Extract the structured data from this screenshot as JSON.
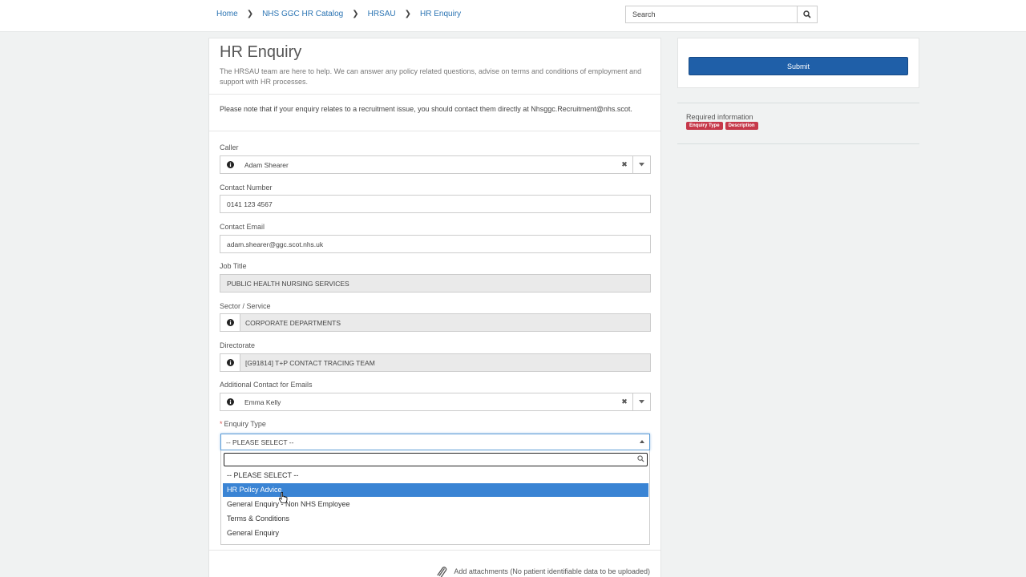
{
  "breadcrumb": [
    "Home",
    "NHS GGC HR Catalog",
    "HRSAU",
    "HR Enquiry"
  ],
  "search": {
    "placeholder": "Search"
  },
  "form": {
    "title": "HR Enquiry",
    "intro": "The HRSAU team are here to help. We can answer any policy related questions, advise on terms and conditions of employment and support with HR processes.",
    "note": "Please note that if your enquiry relates to a recruitment issue, you should contact them directly at Nhsggc.Recruitment@nhs.scot.",
    "caller": {
      "label": "Caller",
      "value": "Adam Shearer"
    },
    "contact_number": {
      "label": "Contact Number",
      "value": "0141 123 4567"
    },
    "contact_email": {
      "label": "Contact Email",
      "value": "adam.shearer@ggc.scot.nhs.uk"
    },
    "job_title": {
      "label": "Job Title",
      "value": "PUBLIC HEALTH NURSING SERVICES"
    },
    "sector": {
      "label": "Sector / Service",
      "value": "CORPORATE DEPARTMENTS"
    },
    "directorate": {
      "label": "Directorate",
      "value": "[G91814] T+P CONTACT TRACING TEAM"
    },
    "additional_contact": {
      "label": "Additional Contact for Emails",
      "value": "Emma Kelly"
    },
    "enquiry_type": {
      "required_mark": "*",
      "label": "Enquiry Type",
      "value": "-- PLEASE SELECT --",
      "search_value": "",
      "options": [
        "-- PLEASE SELECT --",
        "HR Policy Advice",
        "General Enquiry - Non NHS Employee",
        "Terms & Conditions",
        "General Enquiry"
      ],
      "highlighted_index": 1
    },
    "attachments": "Add attachments (No patient identifiable data to be uploaded)"
  },
  "sidebar": {
    "submit_label": "Submit",
    "required_info": "Required information",
    "required_badges": [
      "Enquiry Type",
      "Description"
    ]
  },
  "colors": {
    "primary": "#1f5fa8",
    "highlight": "#3a84d4",
    "badge": "#c6384a",
    "link": "#2b74b3"
  },
  "icons": {
    "info": "info-icon",
    "search": "search-icon",
    "clear": "clear-icon",
    "caret": "caret-down-icon",
    "attach": "paperclip-icon"
  }
}
